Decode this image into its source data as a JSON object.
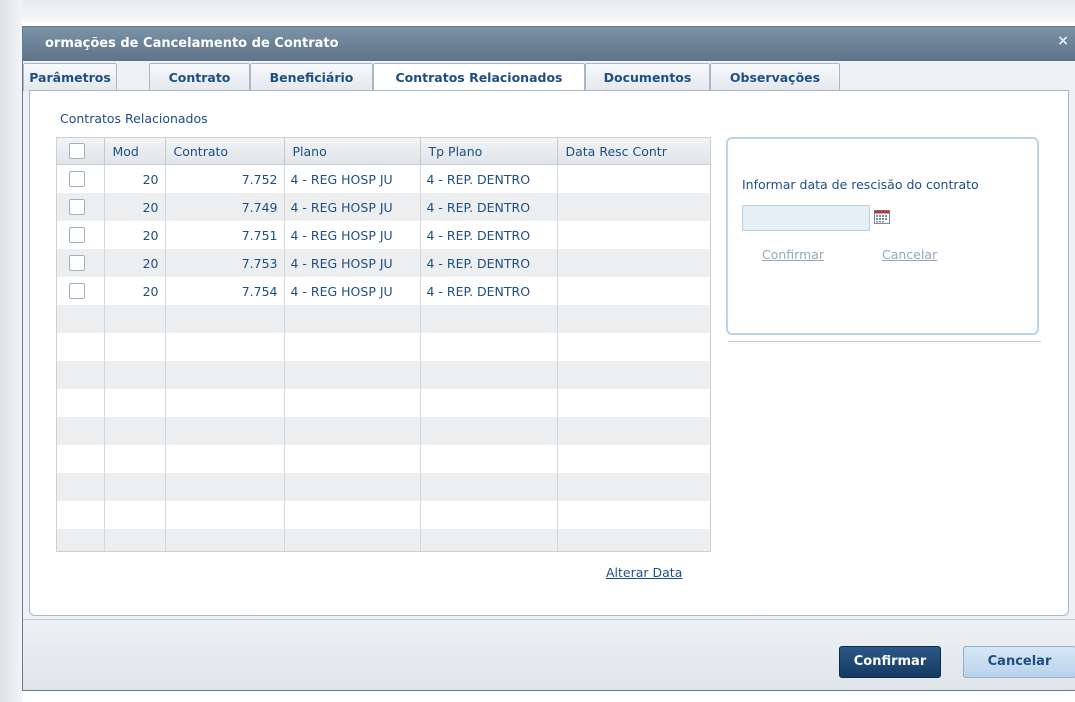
{
  "window": {
    "title": "ormações de Cancelamento de Contrato",
    "close_glyph": "×"
  },
  "tabs": [
    {
      "label": "Parâmetros"
    },
    {
      "label": "Contrato"
    },
    {
      "label": "Beneficiário"
    },
    {
      "label": "Contratos Relacionados",
      "active": true
    },
    {
      "label": "Documentos"
    },
    {
      "label": "Observações"
    }
  ],
  "section": {
    "title": "Contratos Relacionados"
  },
  "grid": {
    "columns": [
      "Mod",
      "Contrato",
      "Plano",
      "Tp Plano",
      "Data Resc Contr"
    ],
    "rows": [
      {
        "mod": "20",
        "contrato": "7.752",
        "plano": "4 - REG HOSP JU",
        "tp_plano": "4 - REP. DENTRO",
        "data_resc": ""
      },
      {
        "mod": "20",
        "contrato": "7.749",
        "plano": "4 - REG HOSP JU",
        "tp_plano": "4 - REP. DENTRO",
        "data_resc": ""
      },
      {
        "mod": "20",
        "contrato": "7.751",
        "plano": "4 - REG HOSP JU",
        "tp_plano": "4 - REP. DENTRO",
        "data_resc": ""
      },
      {
        "mod": "20",
        "contrato": "7.753",
        "plano": "4 - REG HOSP JU",
        "tp_plano": "4 - REP. DENTRO",
        "data_resc": ""
      },
      {
        "mod": "20",
        "contrato": "7.754",
        "plano": "4 - REG HOSP JU",
        "tp_plano": "4 - REP. DENTRO",
        "data_resc": ""
      }
    ]
  },
  "alterar_data_link": "Alterar Data",
  "rescisao": {
    "label": "Informar data de rescisão do contrato",
    "date_value": "",
    "confirm_link": "Confirmar",
    "cancel_link": "Cancelar"
  },
  "footer": {
    "confirm_label": "Confirmar",
    "cancel_label": "Cancelar"
  },
  "colors": {
    "title_bar": "#6e8499",
    "text": "#1d4f85",
    "primary_button": "#1f4a78",
    "secondary_button": "#c8ddf0",
    "disabled_link": "#93a7bb",
    "row_alt": "#eceef0"
  },
  "icons": {
    "calendar": "calendar-icon",
    "close": "close-icon"
  }
}
